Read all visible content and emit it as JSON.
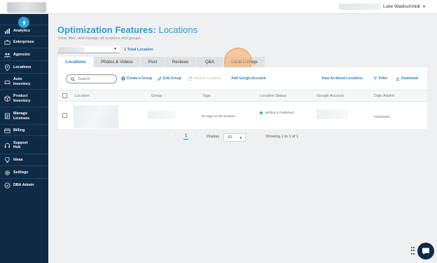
{
  "topbar": {
    "user_name": "Luke Waldschmidt"
  },
  "sidebar": {
    "items": [
      {
        "label": "Analytics",
        "icon": "bar-chart-icon"
      },
      {
        "label": "Enterprises",
        "icon": "enterprise-icon"
      },
      {
        "label": "Agencies",
        "icon": "agencies-icon"
      },
      {
        "label": "Locations",
        "icon": "location-pin-icon"
      },
      {
        "label": "Auto\nInventory",
        "icon": "car-icon"
      },
      {
        "label": "Product\nInventory",
        "icon": "product-icon"
      },
      {
        "label": "Manage\nLicenses",
        "icon": "license-icon"
      },
      {
        "label": "Billing",
        "icon": "credit-card-icon"
      },
      {
        "label": "Support\nHub",
        "icon": "headset-icon"
      },
      {
        "label": "Ideas",
        "icon": "lightbulb-icon"
      },
      {
        "label": "Settings",
        "icon": "gear-icon"
      },
      {
        "label": "DBA Admin",
        "icon": "admin-icon"
      }
    ]
  },
  "header": {
    "title_bold": "Optimization Features:",
    "title_rest": " Locations",
    "subtitle": "View, filter, and manage all locations and groups.",
    "total_locations": "1 Total Location"
  },
  "tabs": [
    {
      "label": "Locations",
      "active": true
    },
    {
      "label": "Photos & Videos",
      "active": false
    },
    {
      "label": "Post",
      "active": false
    },
    {
      "label": "Reviews",
      "active": false
    },
    {
      "label": "Q&A",
      "active": false
    },
    {
      "label": "Local Listings",
      "active": false
    }
  ],
  "toolbar": {
    "search_placeholder": "Search",
    "create_group": "Create a Group",
    "edit_group": "Edit Group",
    "archive_locations": "Archive Locations",
    "add_google_account": "Add Google Account",
    "view_archived": "View Archived Locations",
    "filter": "Filter",
    "download": "Download"
  },
  "table": {
    "columns": [
      "Location",
      "Group",
      "Tags",
      "Location Status",
      "Google Account",
      "Date Added"
    ],
    "rows": [
      {
        "tags": "No tags on this location",
        "status": "Verified & Published",
        "date_added": "03/04/2020"
      }
    ]
  },
  "pager": {
    "prev": "‹",
    "current_page": "1",
    "next": "›",
    "display_label": "Display",
    "display_value": "10",
    "showing": "Showing 1 to 1 of 1"
  },
  "colors": {
    "sidebar_bg": "#0e2b46",
    "accent_blue": "#2a9fd0",
    "link_blue": "#2a7fc0",
    "highlight_orange": "#f0a050",
    "status_green": "#3cb371"
  }
}
